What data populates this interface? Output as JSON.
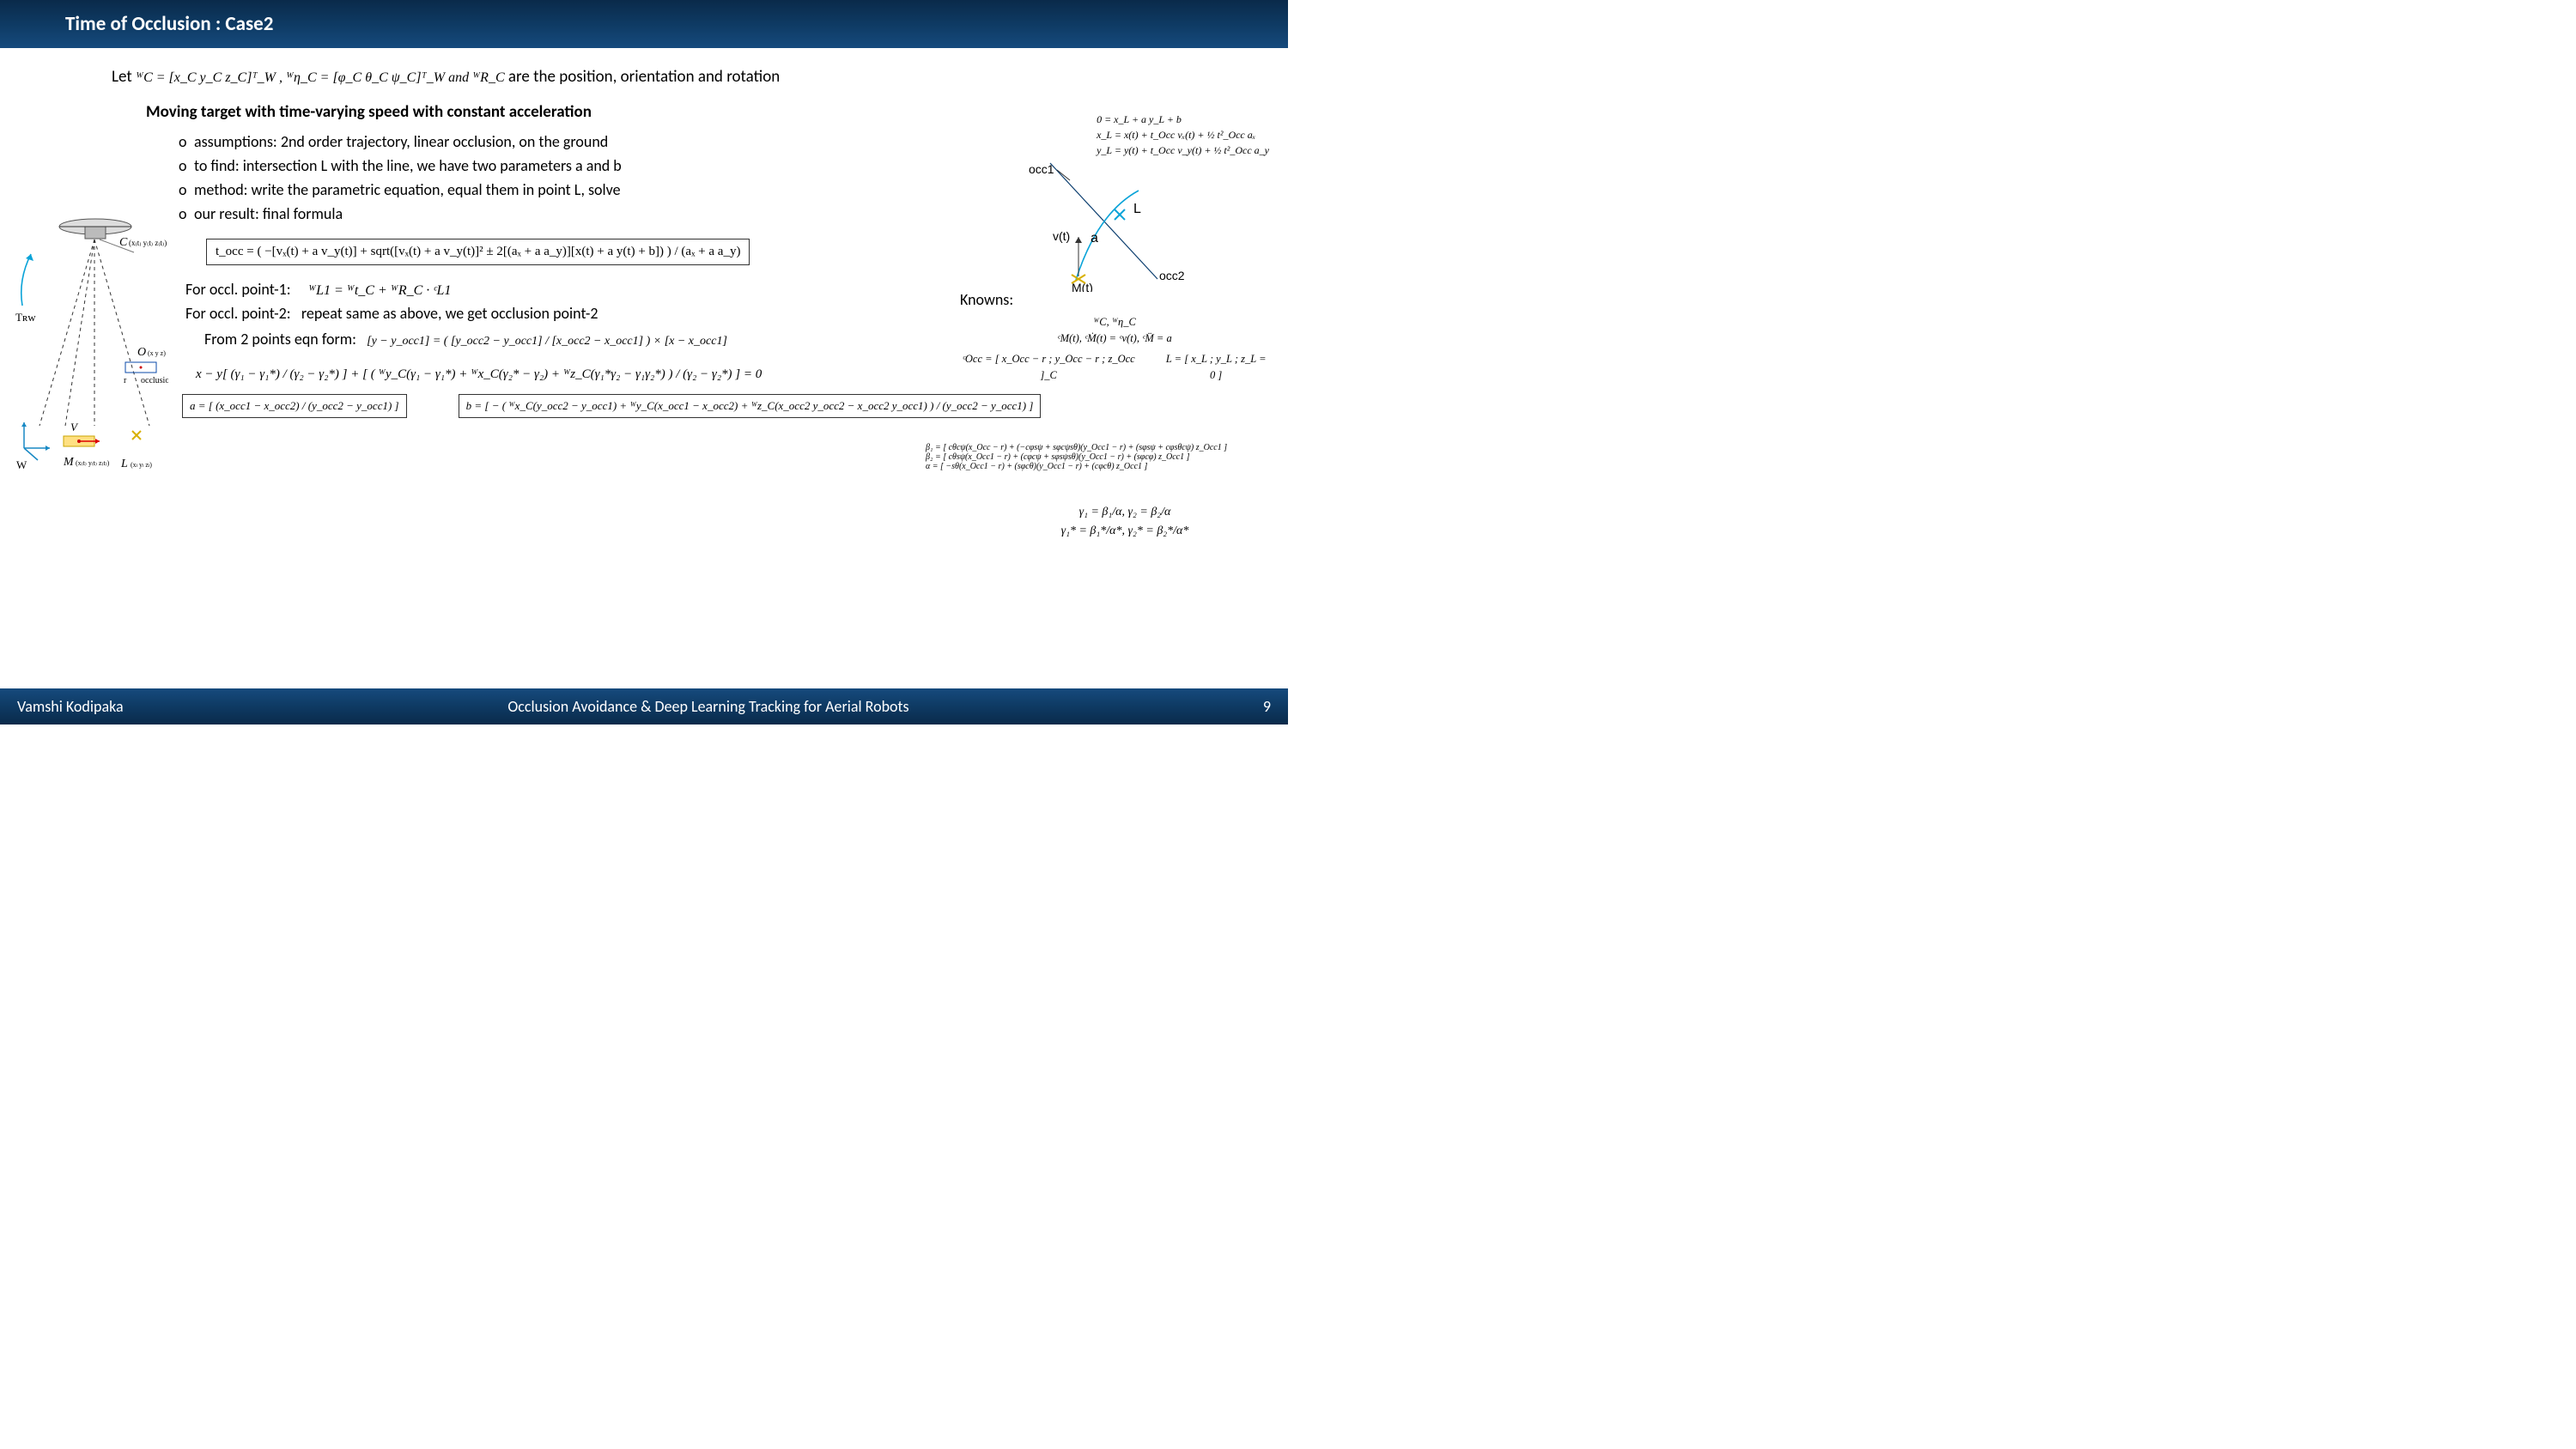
{
  "header": {
    "title": "Time of Occlusion : Case2"
  },
  "footer": {
    "author": "Vamshi Kodipaka",
    "title": "Occlusion Avoidance & Deep Learning Tracking for Aerial Robots",
    "page": "9"
  },
  "let_line": {
    "prefix": "Let  ",
    "math": "ᵂC = [x_C  y_C  z_C]ᵀ_W ,   ᵂη_C = [φ_C  θ_C  ψ_C]ᵀ_W   and  ᵂR_C",
    "suffix": "  are the position, orientation and rotation"
  },
  "subheading": "Moving target with time-varying speed with constant acceleration",
  "bullets": [
    "assumptions: 2nd order trajectory, linear occlusion, on the ground",
    "to find: intersection L with the line, we have two parameters a and b",
    "method: write the parametric equation, equal them in point L, solve",
    "our result: final formula"
  ],
  "tocc_formula": "t_occ = ( −[vₓ(t) + a v_y(t)] + sqrt([vₓ(t) + a v_y(t)]² ± 2[(aₓ + a a_y)][x(t) + a y(t) + b]) ) / (aₓ + a a_y)",
  "for_block": {
    "p1_label": "For occl. point-1:",
    "p1_math": "ᵂL1 = ᵂt_C + ᵂR_C · ᶜL1",
    "p2_label": "For occl. point-2:",
    "p2_text": "repeat same as above,  we get occlusion point-2"
  },
  "two_points": {
    "label": "From 2 points eqn form:",
    "math": "[y − y_occ1] = ( [y_occ2 − y_occ1] / [x_occ2 − x_occ1] ) × [x − x_occ1]"
  },
  "xy_eqn": "x − y[ (γ₁ − γ₁*) / (γ₂ − γ₂*) ] + [ ( ᵂy_C(γ₁ − γ₁*) + ᵂx_C(γ₂* − γ₂) + ᵂz_C(γ₁*γ₂ − γ₁γ₂*) ) / (γ₂ − γ₂*) ] = 0",
  "a_box": "a = [ (x_occ1 − x_occ2) / (y_occ2 − y_occ1) ]",
  "b_box": "b = [ − ( ᵂx_C(y_occ2 − y_occ1) + ᵂy_C(x_occ1 − x_occ2) + ᵂz_C(x_occ2 y_occ2 − x_occ2 y_occ1) ) / (y_occ2 − y_occ1) ]",
  "left_diagram": {
    "trw": "Tʀᴡ",
    "w": "W",
    "c": "C",
    "o": "O",
    "r": "r",
    "occlusion": "occlusion",
    "v": "V",
    "m": "M",
    "l": "L"
  },
  "right_top": {
    "occ1": "occ1",
    "occ2": "occ2",
    "l": "L",
    "vt": "v(t)",
    "a": "a",
    "mt": "M(t)",
    "eq0": "0 = x_L + a y_L + b",
    "eq1": "x_L = x(t) + t_Occ vₓ(t) + ½ t²_Occ aₓ",
    "eq2": "y_L = y(t) + t_Occ v_y(t) + ½ t²_Occ a_y"
  },
  "knowns": {
    "heading": "Knowns:",
    "line1": "ᵂC, ᵂη_C",
    "line2": "ᶜM(t), ᶜṀ(t) = ᶜv(t), ᶜM̈ = a",
    "occ_vec": "ᶜOcc = [ x_Occ − r ;  y_Occ − r ;  z_Occ ]_C",
    "l_vec": "L = [ x_L ;  y_L ;  z_L = 0 ]"
  },
  "betas": {
    "b1": "β₁ = [ cθcψ(x_Occ − r) + (−cφsψ + sφcψsθ)(y_Occ1 − r) + (sφsψ + cφsθcψ) z_Occ1 ]",
    "b2": "β₂ = [ cθsψ(x_Occ1 − r) + (cφcψ + sφsψsθ)(y_Occ1 − r) + (sφcφ) z_Occ1 ]",
    "alpha": "α = [ −sθ(x_Occ1 − r) + (sφcθ)(y_Occ1 − r) + (cφcθ) z_Occ1 ]"
  },
  "gammas": {
    "g1": "γ₁ = β₁/α,  γ₂ = β₂/α",
    "g2": "γ₁* = β₁*/α*,  γ₂* = β₂*/α*"
  }
}
